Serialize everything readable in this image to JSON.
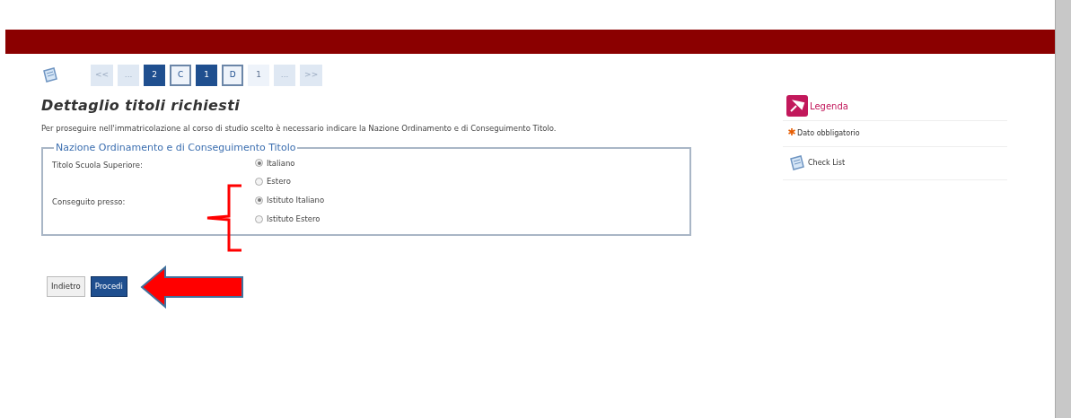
{
  "pager": [
    {
      "label": "<<",
      "kind": "light"
    },
    {
      "label": "...",
      "kind": "light"
    },
    {
      "label": "2",
      "kind": "dark"
    },
    {
      "label": "C",
      "kind": "outlined"
    },
    {
      "label": "1",
      "kind": "dark"
    },
    {
      "label": "D",
      "kind": "outlined"
    },
    {
      "label": "1",
      "kind": "plain"
    },
    {
      "label": "...",
      "kind": "light"
    },
    {
      "label": ">>",
      "kind": "light"
    }
  ],
  "title": "Dettaglio titoli richiesti",
  "intro": "Per proseguire nell'immatricolazione al corso di studio scelto è necessario indicare la Nazione Ordinamento e di Conseguimento Titolo.",
  "fieldset": {
    "legend": "Nazione Ordinamento e di Conseguimento Titolo",
    "groups": [
      {
        "label": "Titolo Scuola Superiore:",
        "options": [
          {
            "label": "Italiano",
            "selected": true
          },
          {
            "label": "Estero",
            "selected": false
          }
        ]
      },
      {
        "label": "Conseguito presso:",
        "options": [
          {
            "label": "Istituto Italiano",
            "selected": true
          },
          {
            "label": "Istituto Estero",
            "selected": false
          }
        ]
      }
    ]
  },
  "buttons": [
    {
      "label": "Indietro",
      "kind": "secondary"
    },
    {
      "label": "Procedi",
      "kind": "primary"
    }
  ],
  "sidebar": {
    "legend": "Legenda",
    "items": [
      {
        "label": "Dato obbligatorio",
        "kind": "required"
      },
      {
        "label": "Check List",
        "kind": "checklist"
      }
    ]
  }
}
